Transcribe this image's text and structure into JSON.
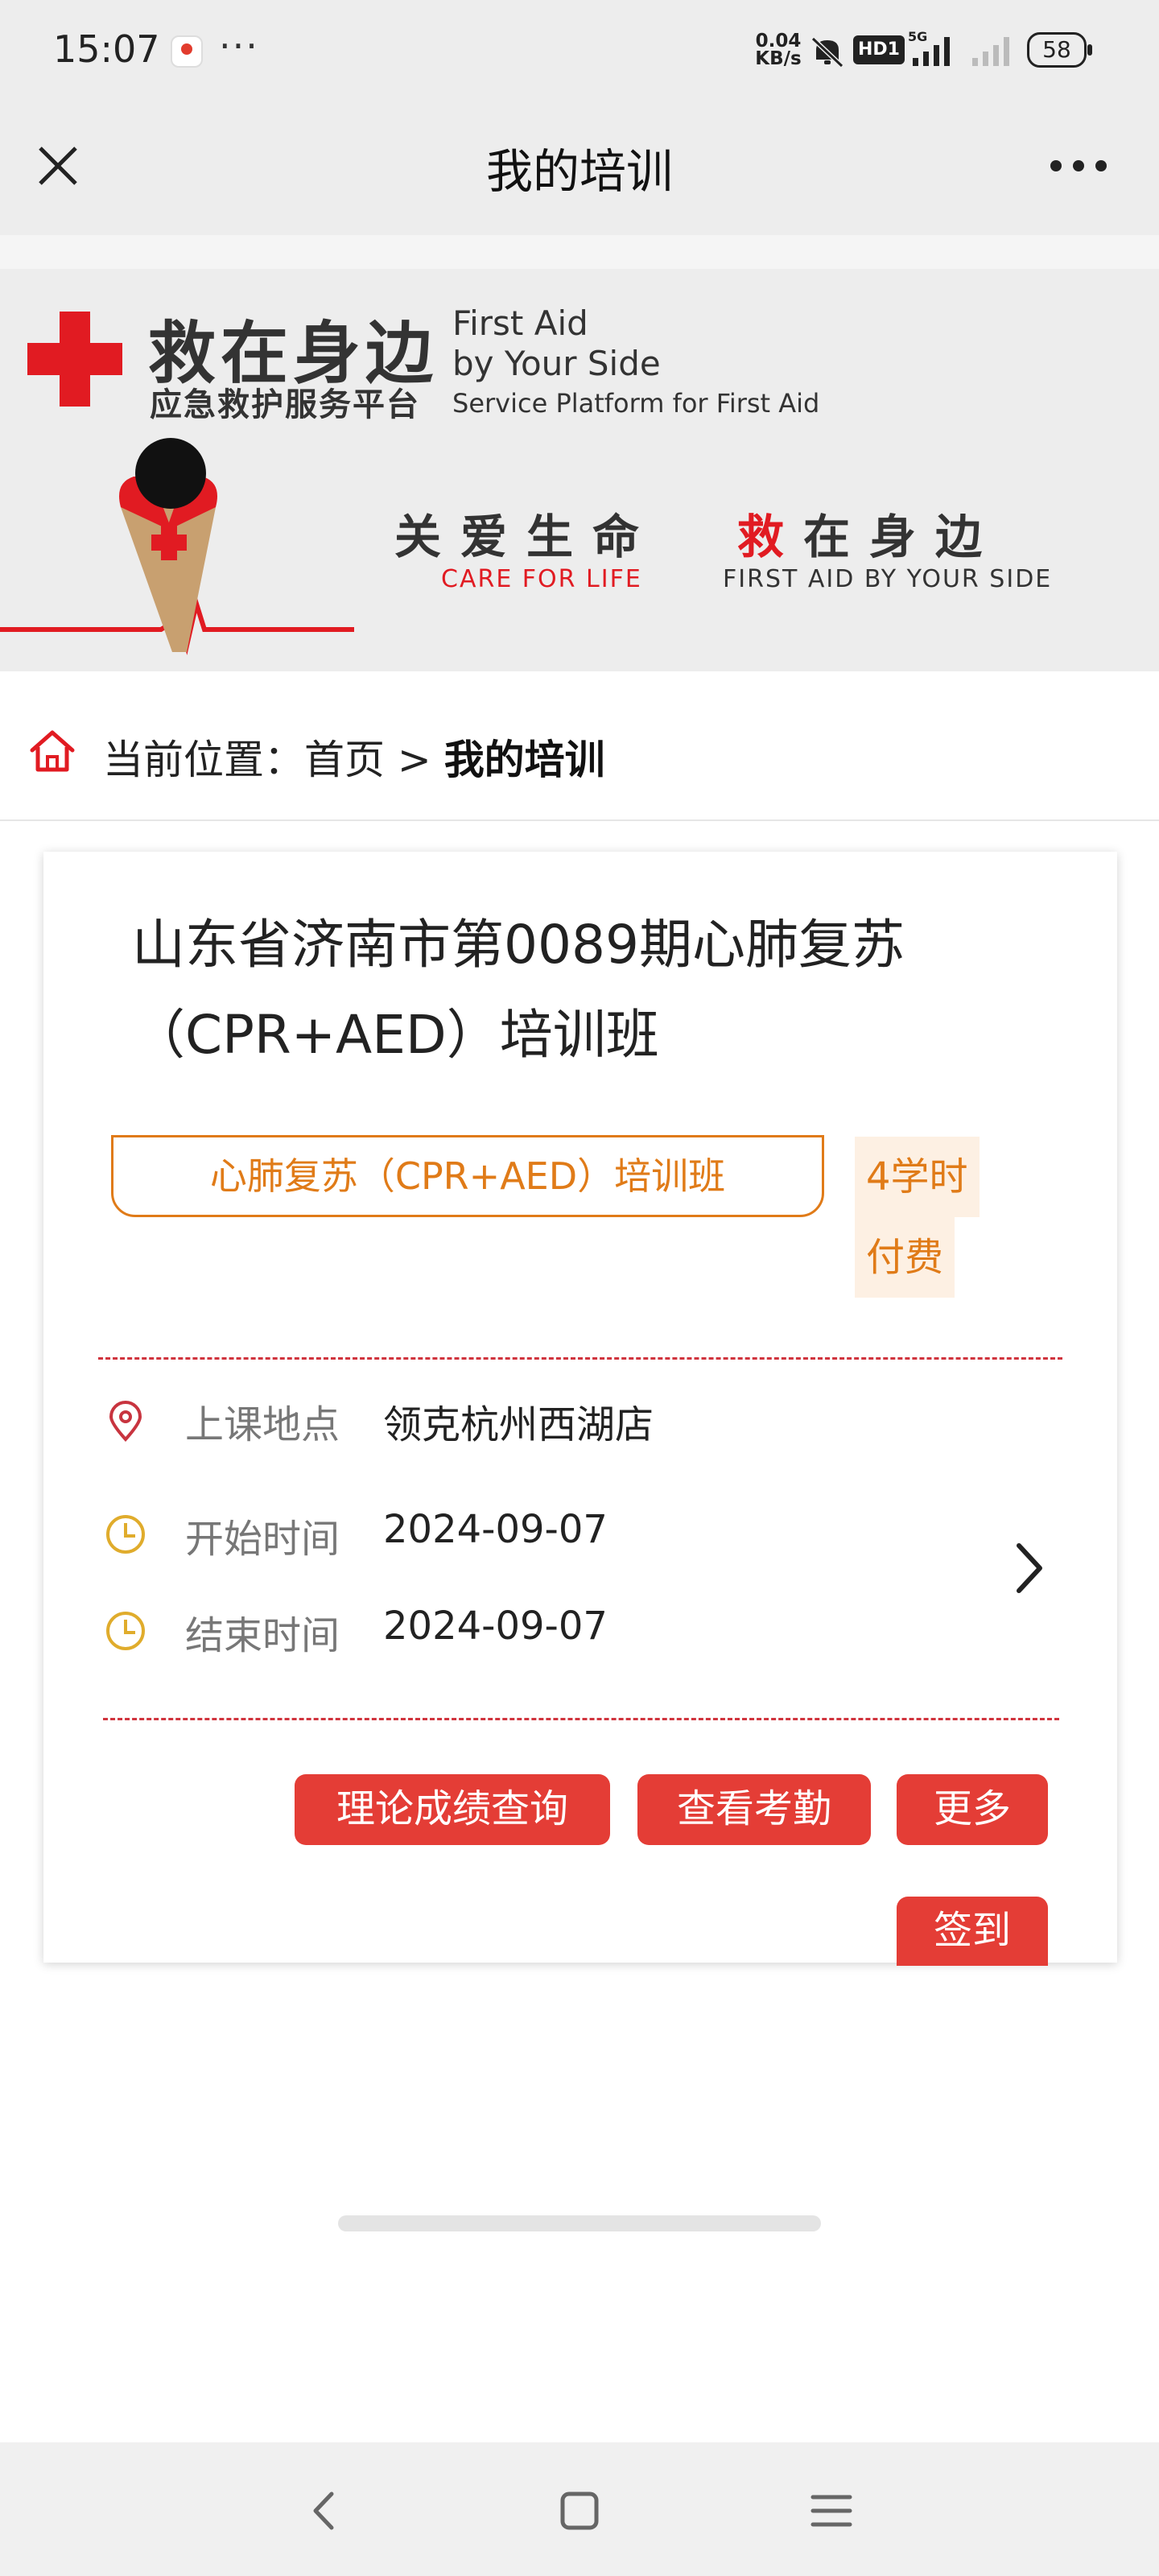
{
  "status_bar": {
    "time": "15:07",
    "menu_dots": "···",
    "net_speed_value": "0.04",
    "net_speed_unit": "KB/s",
    "hd_badge": "HD1",
    "network_type": "5G",
    "battery": "58",
    "icons": [
      "app-notification-icon",
      "mute-icon",
      "signal-icon",
      "battery-icon"
    ]
  },
  "nav": {
    "title": "我的培训",
    "icons": [
      "close-icon",
      "more-icon"
    ]
  },
  "banner": {
    "brand_cn": "救在身边",
    "brand_cn_sub": "应急救护服务平台",
    "brand_en_line1": "First Aid",
    "brand_en_line2": "by Your Side",
    "brand_en_line3": "Service Platform for First Aid",
    "slogan_part1": "关爱生命",
    "slogan_part2_red": "救",
    "slogan_part2_rest": "在身边",
    "slogan_en1": "CARE FOR LIFE",
    "slogan_en2": "FIRST AID BY YOUR SIDE",
    "colors": {
      "brand_red": "#e11b22"
    }
  },
  "breadcrumb": {
    "prefix": "当前位置：",
    "home": "首页",
    "separator": " > ",
    "current": "我的培训",
    "icon": "home-icon"
  },
  "course": {
    "title": "山东省济南市第0089期心肺复苏（CPR+AED）培训班",
    "category_tag": "心肺复苏（CPR+AED）培训班",
    "hours_tag": "4学时",
    "fee_tag": "付费",
    "location_label": "上课地点",
    "location_value": "领克杭州西湖店",
    "start_label": "开始时间",
    "start_value": "2024-09-07",
    "end_label": "结束时间",
    "end_value": "2024-09-07",
    "buttons": {
      "score": "理论成绩查询",
      "attendance": "查看考勤",
      "more": "更多",
      "sign_in": "签到"
    },
    "colors": {
      "accent_orange": "#e07b18",
      "button_red": "#e43d36",
      "divider_red": "#d0343e"
    }
  },
  "system_nav": {
    "icons": [
      "back-icon",
      "home-square-icon",
      "menu-icon"
    ]
  }
}
